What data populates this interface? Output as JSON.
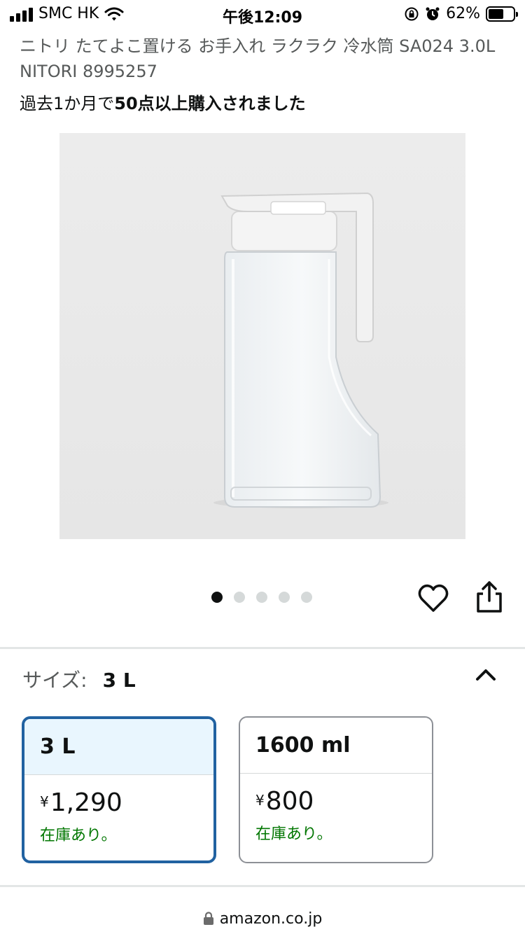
{
  "status_bar": {
    "carrier": "SMC HK",
    "time": "午後12:09",
    "battery_percent": "62%",
    "battery_level": 0.62
  },
  "product": {
    "title": "ニトリ たてよこ置ける お手入れ ラクラク 冷水筒 SA024 3.0L NITORI 8995257",
    "purchase_prefix": "過去1か月で",
    "purchase_bold": "50点以上購入されました"
  },
  "carousel": {
    "count": 5,
    "active": 0
  },
  "size_selector": {
    "label": "サイズ:",
    "selected_value": "3 L",
    "options": [
      {
        "name": "3 L",
        "currency": "¥",
        "price": "1,290",
        "stock": "在庫あり。",
        "selected": true
      },
      {
        "name": "1600 ml",
        "currency": "¥",
        "price": "800",
        "stock": "在庫あり。",
        "selected": false
      }
    ]
  },
  "url_bar": {
    "domain": "amazon.co.jp"
  },
  "colors": {
    "accent": "#2162a1",
    "selected_bg": "#e9f6fe",
    "in_stock": "#007600"
  },
  "icons": [
    "signal-icon",
    "wifi-icon",
    "rotation-lock-icon",
    "alarm-icon",
    "battery-icon",
    "heart-icon",
    "share-icon",
    "chevron-up-icon",
    "lock-icon"
  ]
}
